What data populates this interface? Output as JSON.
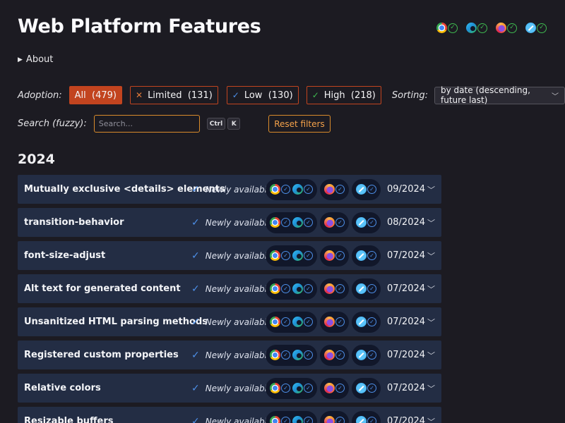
{
  "page": {
    "title": "Web Platform Features",
    "about_label": "About"
  },
  "header_browsers": [
    {
      "name": "chrome",
      "status": "supported"
    },
    {
      "name": "edge",
      "status": "supported"
    },
    {
      "name": "firefox",
      "status": "supported"
    },
    {
      "name": "safari",
      "status": "supported"
    }
  ],
  "filters": {
    "adoption_label": "Adoption:",
    "chips": [
      {
        "label": "All",
        "count": "(479)",
        "icon": "",
        "active": true
      },
      {
        "label": "Limited",
        "count": "(131)",
        "icon": "limited-icon",
        "active": false
      },
      {
        "label": "Low",
        "count": "(130)",
        "icon": "check-icon",
        "active": false
      },
      {
        "label": "High",
        "count": "(218)",
        "icon": "check-icon",
        "active": false
      }
    ],
    "sorting_label": "Sorting:",
    "sorting_value": "by date (descending, future last)",
    "search_label": "Search (fuzzy):",
    "search_placeholder": "Search...",
    "search_value": "",
    "shortcut_keys": [
      "Ctrl",
      "K"
    ],
    "reset_label": "Reset filters"
  },
  "year": "2024",
  "colors": {
    "accent": "#c2441f",
    "reset_orange": "#f5a24a",
    "row_bg": "#232d44",
    "check_blue": "#4d8fe8",
    "check_green": "#3fb950"
  },
  "features": [
    {
      "name": "Mutually exclusive <details> elements",
      "status": "Newly available",
      "date": "09/2024"
    },
    {
      "name": "transition-behavior",
      "status": "Newly available",
      "date": "08/2024"
    },
    {
      "name": "font-size-adjust",
      "status": "Newly available",
      "date": "07/2024"
    },
    {
      "name": "Alt text for generated content",
      "status": "Newly available",
      "date": "07/2024"
    },
    {
      "name": "Unsanitized HTML parsing methods",
      "status": "Newly available",
      "date": "07/2024"
    },
    {
      "name": "Registered custom properties",
      "status": "Newly available",
      "date": "07/2024"
    },
    {
      "name": "Relative colors",
      "status": "Newly available",
      "date": "07/2024"
    },
    {
      "name": "Resizable buffers",
      "status": "Newly available",
      "date": "07/2024"
    }
  ]
}
